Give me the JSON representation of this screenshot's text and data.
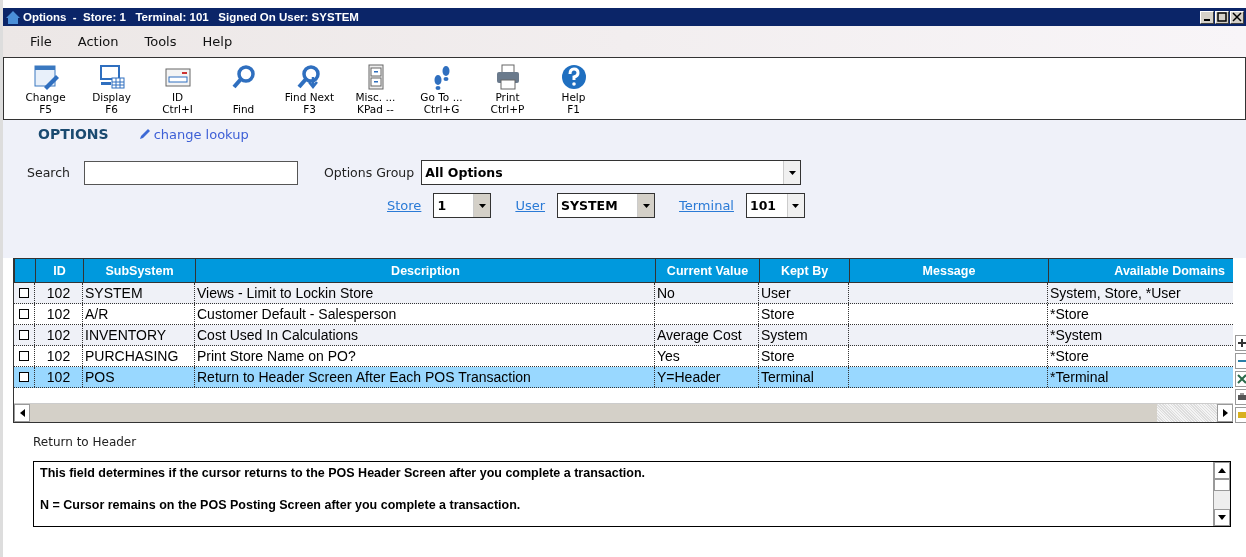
{
  "window": {
    "title": "Options  -  Store: 1   Terminal: 101   Signed On User: SYSTEM"
  },
  "menu": [
    "File",
    "Action",
    "Tools",
    "Help"
  ],
  "toolbar": [
    {
      "kind": "change",
      "label": "Change",
      "shortcut": "F5"
    },
    {
      "kind": "display",
      "label": "Display",
      "shortcut": "F6"
    },
    {
      "kind": "id",
      "label": "ID",
      "shortcut": "Ctrl+I"
    },
    {
      "kind": "find",
      "label": "Find"
    },
    {
      "kind": "findnext",
      "label": "Find Next",
      "shortcut": "F3"
    },
    {
      "kind": "misc",
      "label": "Misc. ...",
      "shortcut": "KPad --"
    },
    {
      "kind": "goto",
      "label": "Go To ...",
      "shortcut": "Ctrl+G"
    },
    {
      "kind": "print",
      "label": "Print",
      "shortcut": "Ctrl+P"
    },
    {
      "kind": "help",
      "label": "Help",
      "shortcut": "F1"
    }
  ],
  "header": {
    "title": "OPTIONS",
    "link": "change lookup"
  },
  "filters": {
    "search_label": "Search",
    "group_label": "Options Group",
    "group_value": "All Options",
    "store_label": "Store",
    "store_value": "1",
    "user_label": "User",
    "user_value": "SYSTEM",
    "terminal_label": "Terminal",
    "terminal_value": "101"
  },
  "table": {
    "columns": [
      "ID",
      "SubSystem",
      "Description",
      "Current Value",
      "Kept By",
      "Message",
      "Available Domains"
    ],
    "rows": [
      {
        "checked": false,
        "selected": false,
        "id": "102",
        "subsystem": "SYSTEM",
        "description": "Views - Limit to Lockin Store",
        "current_value": "No",
        "kept_by": "User",
        "domains": "System, Store, *User"
      },
      {
        "checked": false,
        "selected": false,
        "id": "102",
        "subsystem": "A/R",
        "description": "Customer Default - Salesperson",
        "kept_by": "Store",
        "domains": "*Store"
      },
      {
        "checked": false,
        "selected": false,
        "id": "102",
        "subsystem": "INVENTORY",
        "description": "Cost Used In Calculations",
        "current_value": "Average Cost",
        "kept_by": "System",
        "domains": "*System"
      },
      {
        "checked": false,
        "selected": false,
        "id": "102",
        "subsystem": "PURCHASING",
        "description": "Print Store Name on PO?",
        "current_value": "Yes",
        "kept_by": "Store",
        "domains": "*Store"
      },
      {
        "checked": false,
        "selected": true,
        "id": "102",
        "subsystem": "POS",
        "description": "Return to Header Screen After Each POS Transaction",
        "current_value": "Y=Header",
        "kept_by": "Terminal",
        "domains": "*Terminal"
      }
    ]
  },
  "details": {
    "title": "Return to Header",
    "lines": [
      "This field determines if the cursor returns to the POS Header Screen after you complete a transaction.",
      "N = Cursor remains on the POS Posting Screen after you complete a transaction."
    ]
  }
}
